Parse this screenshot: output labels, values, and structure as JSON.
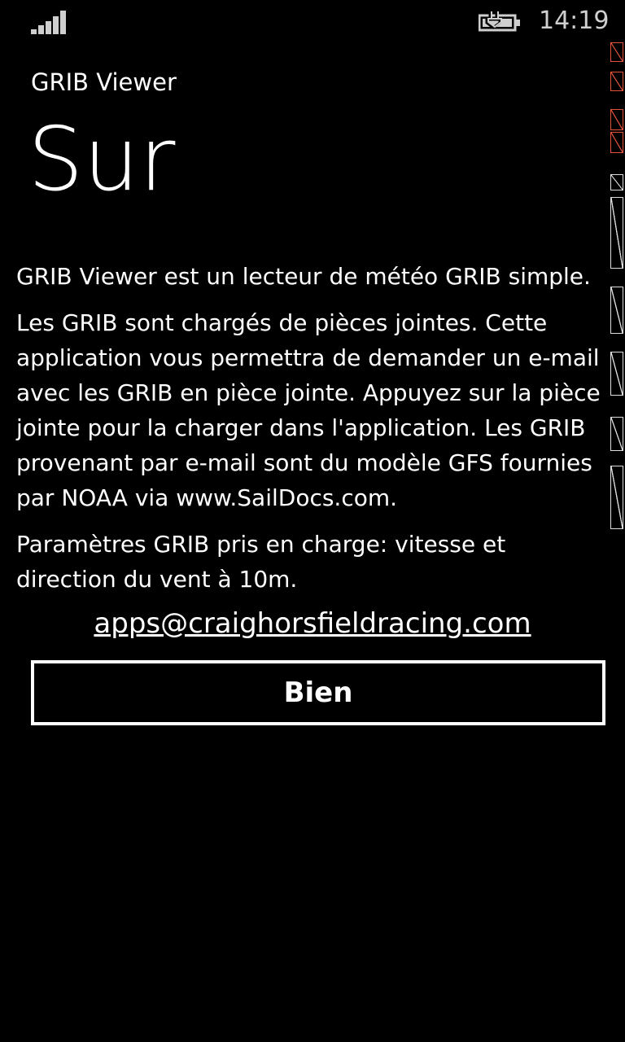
{
  "status_bar": {
    "signal_icon": "signal-strength-icon",
    "battery_icon": "battery-charging-icon",
    "time": "14:19"
  },
  "header": {
    "app_title": "GRIB Viewer",
    "page_title": "Sur"
  },
  "content": {
    "paragraph_1": "GRIB Viewer est un lecteur de météo GRIB simple.",
    "paragraph_2": "Les GRIB sont chargés de pièces jointes. Cette application vous permettra de demander un e-mail avec les GRIB en pièce jointe.  Appuyez sur la pièce jointe pour la charger dans l'application. Les GRIB provenant par e-mail sont du modèle GFS fournies par NOAA via www.SailDocs.com.",
    "paragraph_3": "Paramètres GRIB pris en charge: vitesse et direction du vent à 10m."
  },
  "contact": {
    "email": "apps@craighorsfieldracing.com"
  },
  "actions": {
    "ok_label": "Bien"
  },
  "colors": {
    "background": "#000000",
    "foreground": "#ffffff",
    "status_text": "#cfcfcf",
    "debug_accent": "#e0533a"
  }
}
